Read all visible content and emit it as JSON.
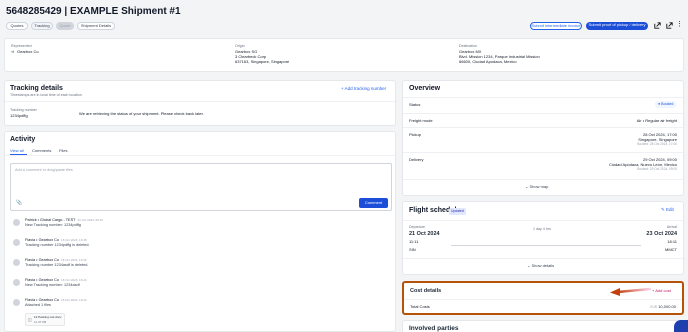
{
  "header": {
    "title": "5648285429 | EXAMPLE Shipment #1",
    "tabs": [
      "Quotes",
      "Tracking",
      "Quote",
      "Shipment Details"
    ],
    "submit_intermediate": "Submit intermediate invoice",
    "submit_proof": "Submit proof of pickup / delivery"
  },
  "parties_strip": {
    "represented_label": "Represented",
    "represented_value": "Gearbox Co",
    "origin_label": "Origin",
    "origin_name": "Gearbox SG",
    "origin_line1": "3 Clearbeck Corp",
    "origin_line2": "637163, Singapore, Singapore",
    "destination_label": "Destination",
    "destination_name": "Gearbox MX",
    "destination_line1": "Blvd. Mission 1234, Parque Industrial Mission",
    "destination_line2": "66600, Ciudad Apodaca, Mexico"
  },
  "tracking": {
    "title": "Tracking details",
    "subtitle": "Timestamps are in local time of each location",
    "add_label": "Add tracking number",
    "number_label": "Tracking number",
    "number_value": "1234pdffg",
    "status_msg": "We are retrieving the status of your shipment. Please check back later."
  },
  "activity": {
    "title": "Activity",
    "tabs": [
      "View all",
      "Comments",
      "Files"
    ],
    "placeholder": "Add a comment or drag/paste files",
    "comment_btn": "Comment",
    "items": [
      {
        "who": "Patrick • Global Cargo - TEST",
        "time": "31 Oct 2024, 09:10",
        "msg": "New Tracking number: 1234pdffg"
      },
      {
        "who": "Flavia • Gearbox Co",
        "time": "18 Oct 2024, 16:38",
        "msg": "Tracking number 1234pdffg is deleted."
      },
      {
        "who": "Flavia • Gearbox Co",
        "time": "18 Oct 2024, 16:36",
        "msg": "Tracking number 1234asdf is deleted."
      },
      {
        "who": "Flavia • Gearbox Co",
        "time": "18 Oct 2024, 16:24",
        "msg": "New Tracking number: 1234asdf"
      },
      {
        "who": "Flavia • Gearbox Co",
        "time": "18 Oct 2024, 16:22",
        "msg": "Attached 1 files"
      }
    ],
    "attachment_name": "12 Packing List.docx",
    "attachment_size": "11.47 KB"
  },
  "overview": {
    "title": "Overview",
    "status_label": "Status",
    "status_value": "Booked",
    "freight_label": "Freight mode",
    "freight_value": "Air • Regular air freight",
    "pickup_label": "Pickup",
    "pickup_date": "28 Oct 2024, 17:00",
    "pickup_place": "Singapore, Singapore",
    "pickup_booked": "Booked: 28 Oct 2024, 17:00",
    "delivery_label": "Delivery",
    "delivery_date": "29 Oct 2024, 09:00",
    "delivery_place": "Ciudad Apodaca, Nuevo León, Mexico",
    "delivery_booked": "Booked: 29 Oct 2024, 09:00",
    "show_map": "Show map"
  },
  "flight": {
    "title": "Flight schedule",
    "badge": "Updated",
    "edit": "Edit",
    "departure_label": "Departure",
    "departure_date": "21 Oct 2024",
    "departure_time": "11:11",
    "departure_code": "SIN",
    "duration": "1 day 4 hrs",
    "arrival_label": "Arrival",
    "arrival_date": "23 Oct 2024",
    "arrival_time": "18:11",
    "arrival_code": "MMCT",
    "show_details": "Show details"
  },
  "cost": {
    "title": "Cost details",
    "add": "Add cost",
    "total_label": "Total Costs",
    "currency": "EUR",
    "total_value": "10,000.00"
  },
  "involved": {
    "title": "Involved parties"
  },
  "colors": {
    "accent": "#2563eb",
    "highlight_border": "#b45309",
    "arrow": "#c2410c"
  }
}
